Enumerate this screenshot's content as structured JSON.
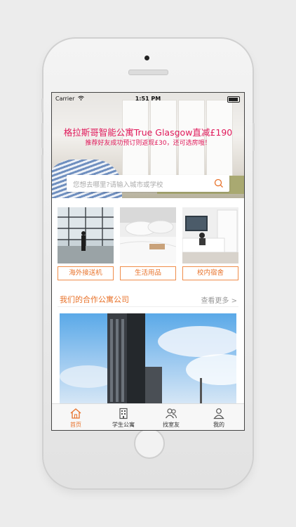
{
  "status_bar": {
    "carrier": "Carrier",
    "time": "1:51 PM"
  },
  "banner": {
    "title": "格拉斯哥智能公寓True Glasgow直减£190",
    "subtitle": "推荐好友成功预订则返现£30，还可选房哦！"
  },
  "search": {
    "placeholder": "您想去哪里?请输入城市或学校"
  },
  "categories": [
    {
      "label": "海外接送机"
    },
    {
      "label": "生活用品"
    },
    {
      "label": "校内宿舍"
    }
  ],
  "section": {
    "title": "我们的合作公寓公司",
    "more": "查看更多 >"
  },
  "tabbar": {
    "items": [
      {
        "label": "首页",
        "icon": "home-icon",
        "active": true
      },
      {
        "label": "学生公寓",
        "icon": "building-icon",
        "active": false
      },
      {
        "label": "找室友",
        "icon": "roommates-icon",
        "active": false
      },
      {
        "label": "我的",
        "icon": "profile-icon",
        "active": false
      }
    ]
  },
  "colors": {
    "accent": "#e8722a",
    "banner_text": "#e0195a"
  }
}
